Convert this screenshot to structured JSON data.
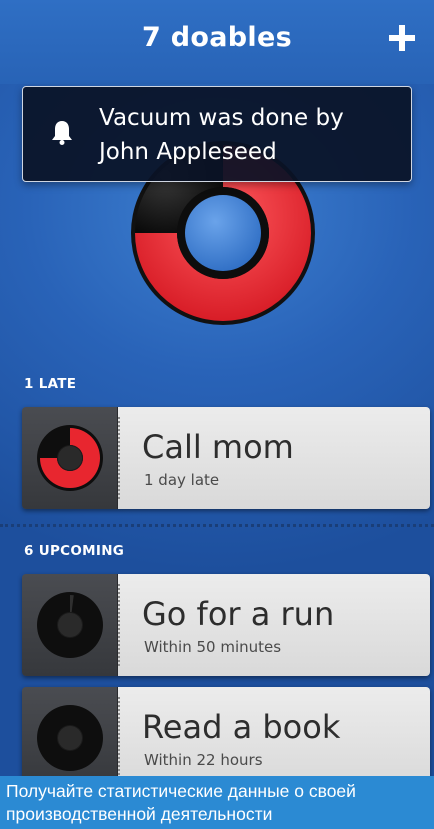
{
  "header": {
    "title": "7 doables",
    "add_icon": "plus-icon"
  },
  "notification": {
    "icon": "bell-icon",
    "text": "Vacuum was done by\nJohn Appleseed"
  },
  "summary_donut": {
    "done_fraction": 0.25,
    "remaining_fraction": 0.75,
    "colors": {
      "remaining": "#e8262f",
      "done": "#1a1a1a",
      "center": "#3b7fd4"
    }
  },
  "sections": {
    "late": {
      "label": "1 LATE",
      "tasks": [
        {
          "title": "Call mom",
          "subtitle": "1 day late",
          "progress": 0.75,
          "indicator_color": "#e8262f"
        }
      ]
    },
    "upcoming": {
      "label": "6 UPCOMING",
      "tasks": [
        {
          "title": "Go for a run",
          "subtitle": "Within 50 minutes",
          "progress": 0.02
        },
        {
          "title": "Read a book",
          "subtitle": "Within 22 hours",
          "progress": 0.0
        }
      ]
    }
  },
  "caption": {
    "text": "Получайте статистические данные о своей производственной деятельности"
  },
  "colors": {
    "background": "#2963b8",
    "accent_red": "#e8262f",
    "caption_bg": "#2b8ad3"
  }
}
